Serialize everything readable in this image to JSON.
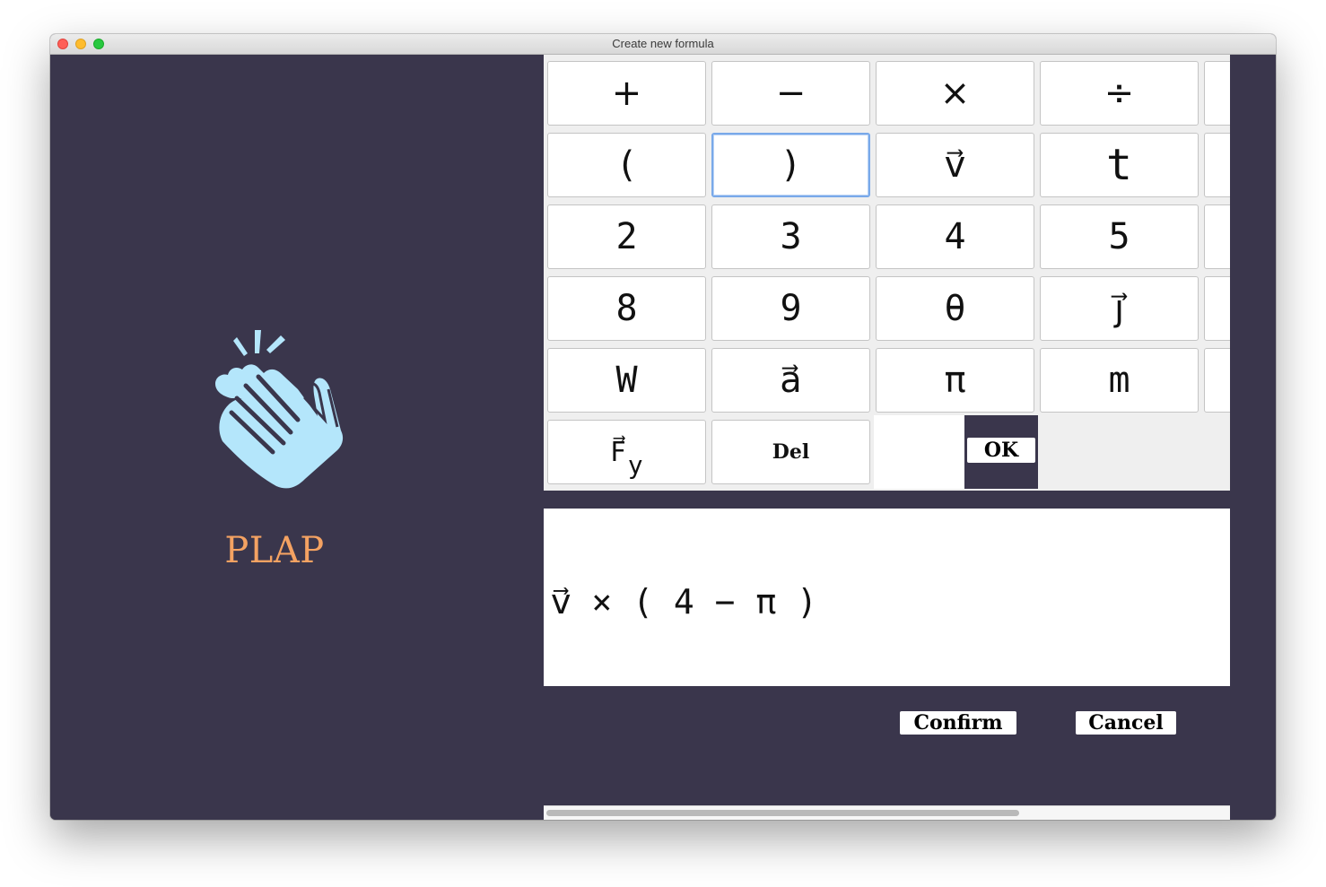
{
  "window": {
    "title": "Create new formula"
  },
  "brand": {
    "name": "PLAP"
  },
  "keypad": {
    "row1": [
      "+",
      "−",
      "×",
      "÷"
    ],
    "row2": [
      "(",
      ")",
      "v⃗",
      "t"
    ],
    "row3": [
      "2",
      "3",
      "4",
      "5"
    ],
    "row4": [
      "8",
      "9",
      "θ",
      "j⃗"
    ],
    "row5": [
      "W",
      "a⃗",
      "π",
      "m"
    ],
    "row6": {
      "f_base": "F⃗",
      "f_sub": "y",
      "del": "Del"
    },
    "ok": "OK"
  },
  "formula": {
    "expression": "v⃗ × ( 4 − π )"
  },
  "actions": {
    "confirm": "Confirm",
    "cancel": "Cancel"
  },
  "colors": {
    "panel": "#3a364c",
    "brand_text": "#f4a262",
    "logo": "#b4e6fb",
    "focus_ring": "#79a9e9"
  },
  "icons": {
    "logo": "clapping-hands-icon"
  }
}
